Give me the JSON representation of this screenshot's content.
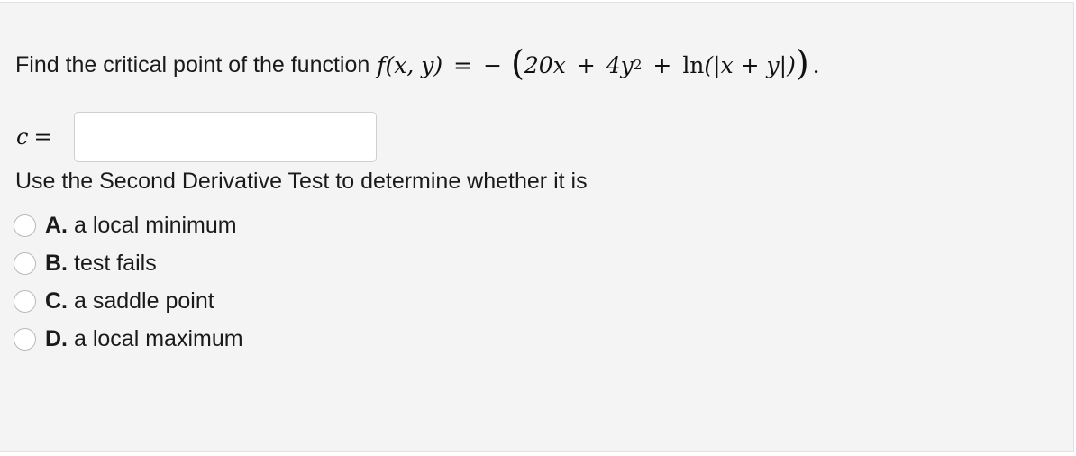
{
  "question": {
    "prompt": "Find the critical point of the function",
    "fx": "f",
    "fargs": "(x, y)",
    "equals": "=",
    "minus": "−",
    "open_paren": "(",
    "term1": "20x",
    "plus1": "+",
    "term2_base": "4y",
    "term2_exp": "2",
    "plus2": "+",
    "ln": "ln",
    "ln_arg": "(|x + y|)",
    "close_paren": ")",
    "end": "."
  },
  "answer": {
    "label": "c",
    "equals": "=",
    "value": "",
    "placeholder": ""
  },
  "instruction": "Use the Second Derivative Test to determine whether it is",
  "options": [
    {
      "letter": "A.",
      "text": "a local minimum"
    },
    {
      "letter": "B.",
      "text": "test fails"
    },
    {
      "letter": "C.",
      "text": "a saddle point"
    },
    {
      "letter": "D.",
      "text": "a local maximum"
    }
  ]
}
